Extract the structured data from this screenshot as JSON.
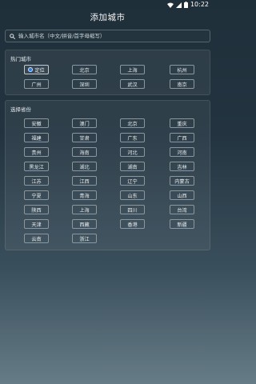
{
  "status_bar": {
    "time": "10:22"
  },
  "header": {
    "title": "添加城市"
  },
  "search": {
    "placeholder": "输入城市名（中文/拼音/首字母缩写）"
  },
  "hot_cities": {
    "title": "热门城市",
    "items": [
      "定位",
      "北京",
      "上海",
      "杭州",
      "广州",
      "深圳",
      "武汉",
      "南京"
    ]
  },
  "provinces": {
    "title": "选择省份",
    "items": [
      "安徽",
      "澳门",
      "北京",
      "重庆",
      "福建",
      "甘肃",
      "广东",
      "广西",
      "贵州",
      "海南",
      "河北",
      "河南",
      "黑龙江",
      "湖北",
      "湖南",
      "吉林",
      "江苏",
      "江西",
      "辽宁",
      "内蒙古",
      "宁夏",
      "青海",
      "山东",
      "山西",
      "陕西",
      "上海",
      "四川",
      "台湾",
      "天津",
      "西藏",
      "香港",
      "新疆",
      "云南",
      "浙江"
    ]
  }
}
